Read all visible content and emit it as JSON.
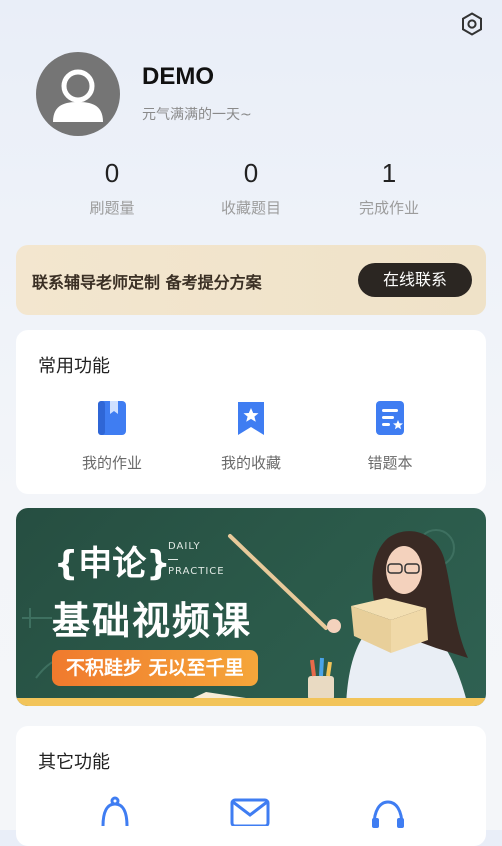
{
  "profile": {
    "username": "DEMO",
    "motto": "元气满满的一天~"
  },
  "stats": [
    {
      "value": "0",
      "label": "刷题量"
    },
    {
      "value": "0",
      "label": "收藏题目"
    },
    {
      "value": "1",
      "label": "完成作业"
    }
  ],
  "consult_banner": {
    "text": "联系辅导老师定制 备考提分方案",
    "button": "在线联系"
  },
  "common_functions": {
    "title": "常用功能",
    "items": [
      {
        "label": "我的作业",
        "icon": "book-icon"
      },
      {
        "label": "我的收藏",
        "icon": "bookmark-star-icon"
      },
      {
        "label": "错题本",
        "icon": "wrong-notes-icon"
      }
    ]
  },
  "promo": {
    "brace_title": "{申论}",
    "daily_line1": "DAILY",
    "daily_line2": "PRACTICE",
    "headline": "基础视频课",
    "slogan": "不积跬步 无以至千里"
  },
  "other_functions": {
    "title": "其它功能",
    "items": [
      {
        "icon": "bell-icon"
      },
      {
        "icon": "mail-icon"
      },
      {
        "icon": "headset-icon"
      }
    ]
  },
  "colors": {
    "accent_blue": "#3f7df2",
    "banner_bg": "#f3e6cf",
    "banner_button": "#2b2622",
    "promo_bg": "#2b5a4a",
    "slogan_orange": "#f07a2d"
  }
}
